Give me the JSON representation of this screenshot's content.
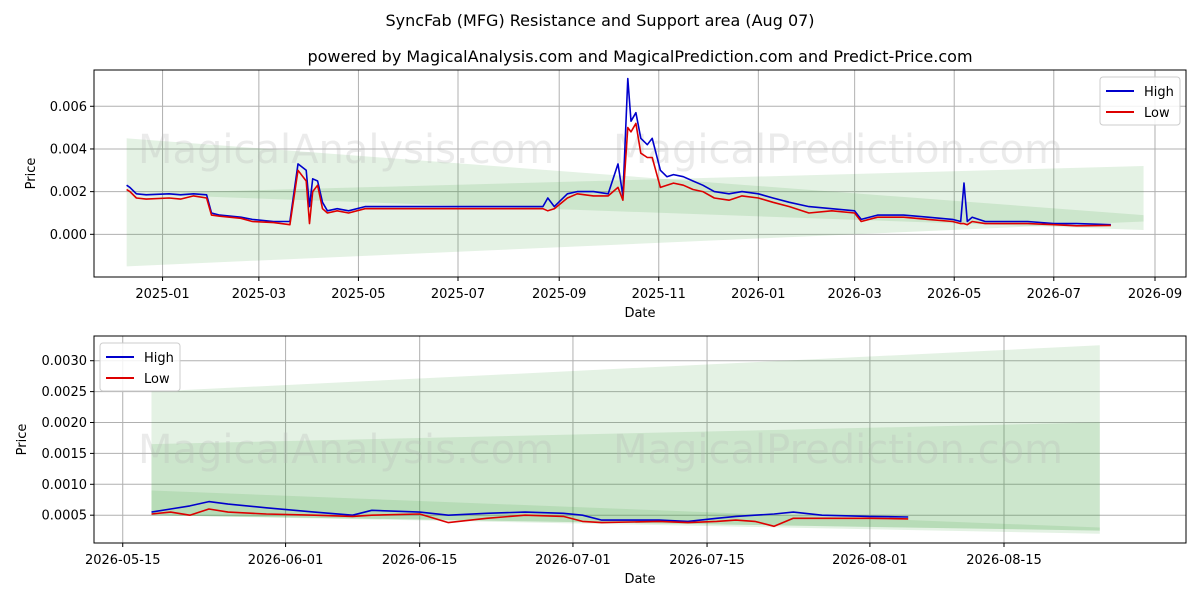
{
  "title": "SyncFab (MFG) Resistance and Support area (Aug 07)",
  "subtitle": "powered by MagicalAnalysis.com and MagicalPrediction.com and Predict-Price.com",
  "watermarks": [
    "MagicalAnalysis.com",
    "MagicalPrediction.com"
  ],
  "colors": {
    "high": "#0000cc",
    "low": "#dd0000",
    "band": "#2e9e2e"
  },
  "chart_data": [
    {
      "type": "line",
      "xlabel": "Date",
      "ylabel": "Price",
      "xlim": [
        "2024-11-20",
        "2026-09-20"
      ],
      "ylim": [
        -0.002,
        0.0077
      ],
      "xticks": [
        "2025-01",
        "2025-03",
        "2025-05",
        "2025-07",
        "2025-09",
        "2025-11",
        "2026-01",
        "2026-03",
        "2026-05",
        "2026-07",
        "2026-09"
      ],
      "yticks": [
        0.0,
        0.002,
        0.004,
        0.006
      ],
      "ytick_labels": [
        "0.000",
        "0.002",
        "0.004",
        "0.006"
      ],
      "grid": true,
      "legend": "top-right",
      "legend_entries": [
        "High",
        "Low"
      ],
      "bands": [
        {
          "x": [
            "2024-12-10",
            "2026-08-25"
          ],
          "upper": [
            0.0045,
            0.0009
          ],
          "lower": [
            0.0019,
            0.0002
          ]
        },
        {
          "x": [
            "2024-12-10",
            "2026-08-25"
          ],
          "upper": [
            0.0019,
            0.0032
          ],
          "lower": [
            -0.0015,
            0.0006
          ]
        }
      ],
      "series": [
        {
          "name": "High",
          "x": [
            "2024-12-10",
            "2024-12-12",
            "2024-12-16",
            "2024-12-22",
            "2025-01-05",
            "2025-01-12",
            "2025-01-20",
            "2025-01-28",
            "2025-01-31",
            "2025-02-05",
            "2025-02-18",
            "2025-02-25",
            "2025-03-10",
            "2025-03-20",
            "2025-03-25",
            "2025-03-30",
            "2025-04-01",
            "2025-04-03",
            "2025-04-06",
            "2025-04-09",
            "2025-04-12",
            "2025-04-18",
            "2025-04-25",
            "2025-05-05",
            "2025-06-01",
            "2025-07-01",
            "2025-08-01",
            "2025-08-22",
            "2025-08-25",
            "2025-08-29",
            "2025-09-06",
            "2025-09-12",
            "2025-09-22",
            "2025-10-01",
            "2025-10-07",
            "2025-10-10",
            "2025-10-13",
            "2025-10-15",
            "2025-10-18",
            "2025-10-21",
            "2025-10-25",
            "2025-10-28",
            "2025-11-02",
            "2025-11-06",
            "2025-11-10",
            "2025-11-16",
            "2025-11-22",
            "2025-11-28",
            "2025-12-05",
            "2025-12-14",
            "2025-12-22",
            "2026-01-01",
            "2026-01-10",
            "2026-01-20",
            "2026-02-01",
            "2026-02-15",
            "2026-03-01",
            "2026-03-05",
            "2026-03-15",
            "2026-03-31",
            "2026-04-15",
            "2026-04-30",
            "2026-05-05",
            "2026-05-07",
            "2026-05-09",
            "2026-05-12",
            "2026-05-20",
            "2026-06-15",
            "2026-07-01",
            "2026-07-15",
            "2026-08-05"
          ],
          "values": [
            0.0023,
            0.0022,
            0.0019,
            0.00185,
            0.0019,
            0.00185,
            0.0019,
            0.00185,
            0.001,
            0.0009,
            0.0008,
            0.0007,
            0.0006,
            0.0006,
            0.0033,
            0.003,
            0.0013,
            0.0026,
            0.0025,
            0.0015,
            0.0011,
            0.0012,
            0.0011,
            0.0013,
            0.0013,
            0.0013,
            0.0013,
            0.0013,
            0.0017,
            0.0013,
            0.0019,
            0.002,
            0.002,
            0.0019,
            0.0033,
            0.0018,
            0.0073,
            0.0053,
            0.0057,
            0.0045,
            0.0042,
            0.0045,
            0.003,
            0.0027,
            0.0028,
            0.0027,
            0.0025,
            0.0023,
            0.002,
            0.0019,
            0.002,
            0.0019,
            0.0017,
            0.0015,
            0.0013,
            0.0012,
            0.0011,
            0.0007,
            0.0009,
            0.0009,
            0.0008,
            0.0007,
            0.0006,
            0.0024,
            0.0006,
            0.0008,
            0.0006,
            0.0006,
            0.0005,
            0.0005,
            0.00045
          ]
        },
        {
          "name": "Low",
          "x": [
            "2024-12-10",
            "2024-12-12",
            "2024-12-16",
            "2024-12-22",
            "2025-01-05",
            "2025-01-12",
            "2025-01-20",
            "2025-01-28",
            "2025-01-31",
            "2025-02-05",
            "2025-02-18",
            "2025-02-25",
            "2025-03-10",
            "2025-03-20",
            "2025-03-25",
            "2025-03-30",
            "2025-04-01",
            "2025-04-03",
            "2025-04-06",
            "2025-04-09",
            "2025-04-12",
            "2025-04-18",
            "2025-04-25",
            "2025-05-05",
            "2025-06-01",
            "2025-07-01",
            "2025-08-01",
            "2025-08-22",
            "2025-08-25",
            "2025-08-29",
            "2025-09-06",
            "2025-09-12",
            "2025-09-22",
            "2025-10-01",
            "2025-10-07",
            "2025-10-10",
            "2025-10-13",
            "2025-10-15",
            "2025-10-18",
            "2025-10-21",
            "2025-10-25",
            "2025-10-28",
            "2025-11-02",
            "2025-11-06",
            "2025-11-10",
            "2025-11-16",
            "2025-11-22",
            "2025-11-28",
            "2025-12-05",
            "2025-12-14",
            "2025-12-22",
            "2026-01-01",
            "2026-01-10",
            "2026-01-20",
            "2026-02-01",
            "2026-02-15",
            "2026-03-01",
            "2026-03-05",
            "2026-03-15",
            "2026-03-31",
            "2026-04-15",
            "2026-04-30",
            "2026-05-05",
            "2026-05-07",
            "2026-05-09",
            "2026-05-12",
            "2026-05-20",
            "2026-06-15",
            "2026-07-01",
            "2026-07-15",
            "2026-08-05"
          ],
          "values": [
            0.0021,
            0.002,
            0.0017,
            0.00165,
            0.0017,
            0.00165,
            0.0018,
            0.0017,
            0.0009,
            0.00085,
            0.00075,
            0.0006,
            0.00055,
            0.00045,
            0.003,
            0.0025,
            0.0005,
            0.002,
            0.0023,
            0.0012,
            0.001,
            0.0011,
            0.001,
            0.0012,
            0.0012,
            0.0012,
            0.0012,
            0.0012,
            0.0011,
            0.0012,
            0.0017,
            0.0019,
            0.0018,
            0.0018,
            0.0022,
            0.0016,
            0.005,
            0.0048,
            0.0052,
            0.0038,
            0.0036,
            0.0036,
            0.0022,
            0.0023,
            0.0024,
            0.0023,
            0.0021,
            0.002,
            0.0017,
            0.0016,
            0.0018,
            0.0017,
            0.0015,
            0.0013,
            0.001,
            0.0011,
            0.001,
            0.0006,
            0.0008,
            0.0008,
            0.0007,
            0.0006,
            0.0005,
            0.0005,
            0.00045,
            0.0006,
            0.0005,
            0.0005,
            0.00045,
            0.0004,
            0.00042
          ]
        }
      ]
    },
    {
      "type": "line",
      "xlabel": "Date",
      "ylabel": "Price",
      "xlim": [
        "2026-05-12",
        "2026-09-03"
      ],
      "ylim": [
        5e-05,
        0.0034
      ],
      "xticks": [
        "2026-05-15",
        "2026-06-01",
        "2026-06-15",
        "2026-07-01",
        "2026-07-15",
        "2026-08-01",
        "2026-08-15"
      ],
      "yticks": [
        0.0005,
        0.001,
        0.0015,
        0.002,
        0.0025,
        0.003
      ],
      "ytick_labels": [
        "0.0005",
        "0.0010",
        "0.0015",
        "0.0020",
        "0.0025",
        "0.0030"
      ],
      "grid": true,
      "legend": "top-left",
      "legend_entries": [
        "High",
        "Low"
      ],
      "bands": [
        {
          "x": [
            "2026-05-18",
            "2026-08-25"
          ],
          "upper": [
            0.0025,
            0.00325
          ],
          "lower": [
            0.0005,
            0.00025
          ]
        },
        {
          "x": [
            "2026-05-18",
            "2026-08-25"
          ],
          "upper": [
            0.00165,
            0.002
          ],
          "lower": [
            0.0005,
            0.00025
          ]
        },
        {
          "x": [
            "2026-05-18",
            "2026-08-25"
          ],
          "upper": [
            0.0009,
            0.0003
          ],
          "lower": [
            0.0005,
            0.0002
          ]
        }
      ],
      "series": [
        {
          "name": "High",
          "x": [
            "2026-05-18",
            "2026-05-20",
            "2026-05-22",
            "2026-05-24",
            "2026-05-26",
            "2026-05-30",
            "2026-06-04",
            "2026-06-08",
            "2026-06-10",
            "2026-06-15",
            "2026-06-18",
            "2026-06-22",
            "2026-06-26",
            "2026-06-30",
            "2026-07-02",
            "2026-07-04",
            "2026-07-10",
            "2026-07-13",
            "2026-07-16",
            "2026-07-18",
            "2026-07-20",
            "2026-07-22",
            "2026-07-24",
            "2026-07-27",
            "2026-08-01",
            "2026-08-05"
          ],
          "values": [
            0.00055,
            0.0006,
            0.00065,
            0.00072,
            0.00068,
            0.00062,
            0.00055,
            0.0005,
            0.00058,
            0.00055,
            0.0005,
            0.00053,
            0.00055,
            0.00053,
            0.0005,
            0.00042,
            0.00042,
            0.0004,
            0.00045,
            0.00048,
            0.0005,
            0.00052,
            0.00055,
            0.0005,
            0.00048,
            0.00047
          ]
        },
        {
          "name": "Low",
          "x": [
            "2026-05-18",
            "2026-05-20",
            "2026-05-22",
            "2026-05-24",
            "2026-05-26",
            "2026-05-30",
            "2026-06-04",
            "2026-06-08",
            "2026-06-10",
            "2026-06-15",
            "2026-06-18",
            "2026-06-22",
            "2026-06-26",
            "2026-06-30",
            "2026-07-02",
            "2026-07-04",
            "2026-07-10",
            "2026-07-13",
            "2026-07-16",
            "2026-07-18",
            "2026-07-20",
            "2026-07-22",
            "2026-07-24",
            "2026-07-27",
            "2026-08-01",
            "2026-08-05"
          ],
          "values": [
            0.00052,
            0.00055,
            0.0005,
            0.0006,
            0.00055,
            0.00052,
            0.0005,
            0.00048,
            0.0005,
            0.00052,
            0.00038,
            0.00045,
            0.0005,
            0.00048,
            0.0004,
            0.00038,
            0.0004,
            0.00038,
            0.0004,
            0.00042,
            0.0004,
            0.00032,
            0.00045,
            0.00045,
            0.00045,
            0.00044
          ]
        }
      ]
    }
  ]
}
